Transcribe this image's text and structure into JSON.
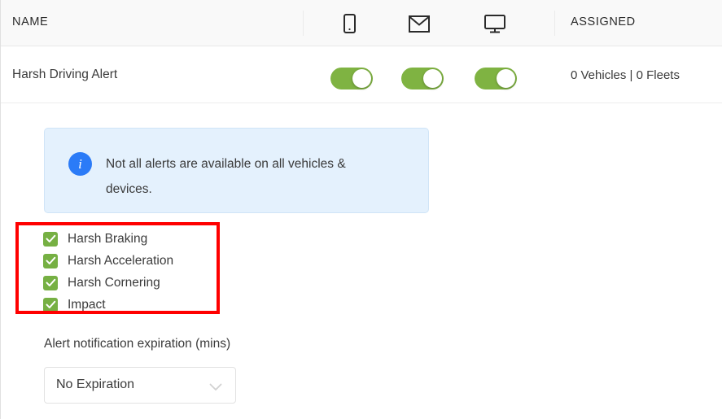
{
  "table": {
    "columns": {
      "name": "NAME",
      "assigned": "ASSIGNED"
    },
    "channel_icons": [
      {
        "name": "mobile-icon",
        "title": "Mobile"
      },
      {
        "name": "email-icon",
        "title": "Email"
      },
      {
        "name": "desktop-icon",
        "title": "Desktop"
      }
    ],
    "rows": [
      {
        "name": "Harsh Driving Alert",
        "toggles": [
          {
            "channel": "mobile",
            "on": true
          },
          {
            "channel": "email",
            "on": true
          },
          {
            "channel": "desktop",
            "on": true
          }
        ],
        "assigned": "0 Vehicles | 0 Fleets"
      }
    ]
  },
  "info_banner": {
    "icon": "info-circle-icon",
    "message": "Not all alerts are available on all vehicles & devices."
  },
  "alert_types": {
    "items": [
      {
        "label": "Harsh Braking",
        "checked": true
      },
      {
        "label": "Harsh Acceleration",
        "checked": true
      },
      {
        "label": "Harsh Cornering",
        "checked": true
      },
      {
        "label": "Impact",
        "checked": true
      }
    ]
  },
  "expiration": {
    "label": "Alert notification expiration (mins)",
    "selected": "No Expiration",
    "chevron": "chevron-down-icon"
  },
  "colors": {
    "toggle_on": "#7fb342",
    "checkbox": "#76b043",
    "info_blue": "#2b7bf7",
    "info_bg": "#e4f1fd",
    "annotation_red": "#ff0000",
    "header_bg": "#f9f9f9"
  }
}
